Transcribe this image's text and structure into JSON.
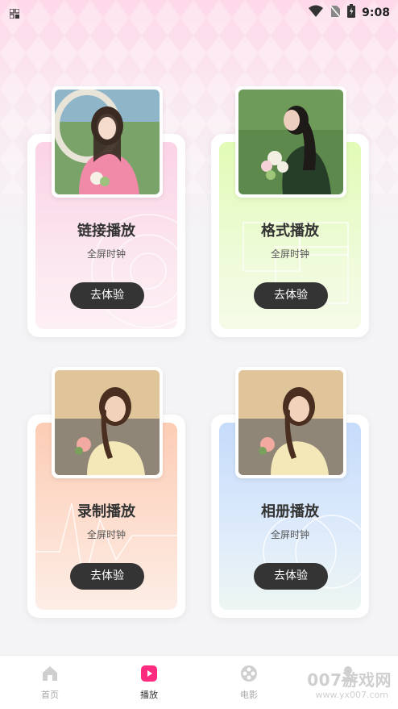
{
  "status_bar": {
    "time": "9:08"
  },
  "cards": [
    {
      "title": "链接播放",
      "subtitle": "全屏时钟",
      "button": "去体验"
    },
    {
      "title": "格式播放",
      "subtitle": "全屏时钟",
      "button": "去体验"
    },
    {
      "title": "录制播放",
      "subtitle": "全屏时钟",
      "button": "去体验"
    },
    {
      "title": "相册播放",
      "subtitle": "全屏时钟",
      "button": "去体验"
    }
  ],
  "nav": [
    {
      "label": "首页",
      "icon": "home-icon",
      "active": false
    },
    {
      "label": "播放",
      "icon": "play-icon",
      "active": true
    },
    {
      "label": "电影",
      "icon": "film-reel-icon",
      "active": false
    },
    {
      "label": "",
      "icon": "profile-icon",
      "active": false
    }
  ],
  "watermark": {
    "main": "007游戏网",
    "sub": "www.yx007.com"
  },
  "colors": {
    "accent": "#ff2b7e",
    "button": "#343434",
    "card1": "#fbd3e6",
    "card2": "#e2fbb6",
    "card3": "#fccdb5",
    "card4": "#c6dcfb"
  }
}
